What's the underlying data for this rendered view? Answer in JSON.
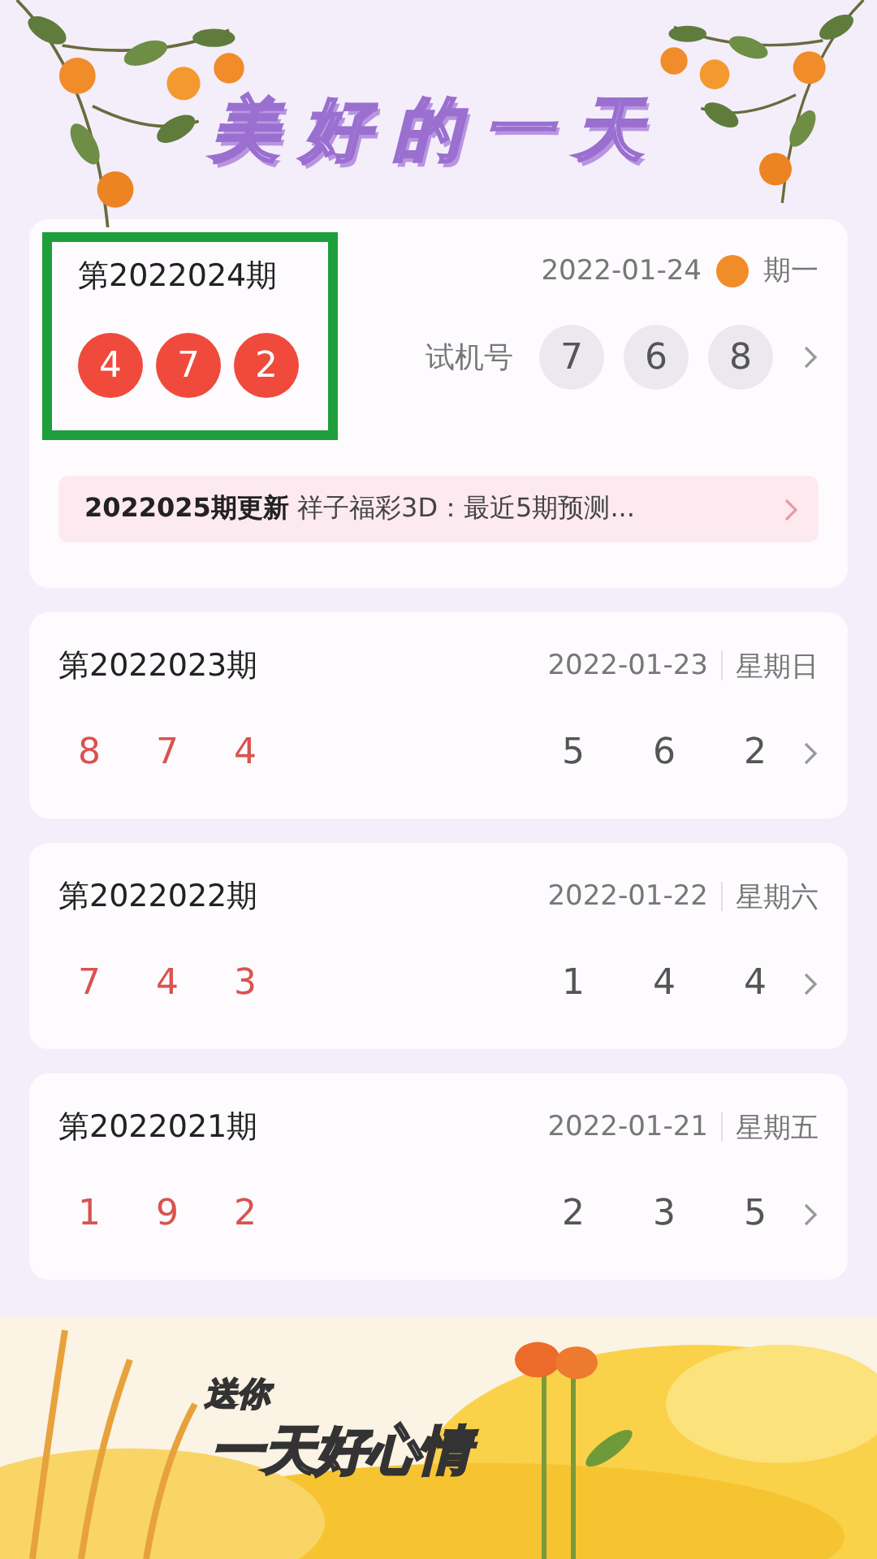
{
  "header": {
    "title": "美好的一天"
  },
  "latest": {
    "issue": "第2022024期",
    "date": "2022-01-24",
    "weekday": "期一",
    "numbers": [
      "4",
      "7",
      "2"
    ],
    "trial_label": "试机号",
    "trial_numbers": [
      "7",
      "6",
      "8"
    ],
    "highlighted": true,
    "notice": {
      "title": "2022025期更新",
      "text": "祥子福彩3D：最近5期预测..."
    }
  },
  "history": [
    {
      "issue": "第2022023期",
      "date": "2022-01-23",
      "weekday": "星期日",
      "numbers": [
        "8",
        "7",
        "4"
      ],
      "trial_numbers": [
        "5",
        "6",
        "2"
      ]
    },
    {
      "issue": "第2022022期",
      "date": "2022-01-22",
      "weekday": "星期六",
      "numbers": [
        "7",
        "4",
        "3"
      ],
      "trial_numbers": [
        "1",
        "4",
        "4"
      ]
    },
    {
      "issue": "第2022021期",
      "date": "2022-01-21",
      "weekday": "星期五",
      "numbers": [
        "1",
        "9",
        "2"
      ],
      "trial_numbers": [
        "2",
        "3",
        "5"
      ]
    }
  ],
  "overlay": {
    "line_1": "送你",
    "line_2": "一天好心情"
  }
}
